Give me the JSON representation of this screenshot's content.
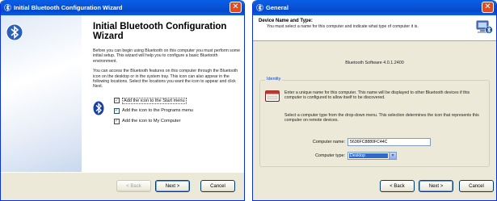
{
  "left_window": {
    "title": "Initial Bluetooth Configuration Wizard",
    "heading": "Initial Bluetooth Configuration Wizard",
    "para1": "Before you can begin using Bluetooth on this computer you must perform some initial setup. This wizard will help you to configure a basic Bluetooth environment.",
    "para2": "You can access the Bluetooth features on this computer through the Bluetooth icon on the desktop or in the system tray. This icon can also appear in the following locations. Select the locations you want the icon to appear and click Next.",
    "checkboxes": [
      {
        "label": "Add the icon to the Start menu",
        "checked": true
      },
      {
        "label": "Add the icon to the Programs menu",
        "checked": true
      },
      {
        "label": "Add the icon to My Computer",
        "checked": true
      }
    ],
    "buttons": {
      "back": "< Back",
      "next": "Next >",
      "cancel": "Cancel"
    }
  },
  "right_window": {
    "title": "General",
    "header_title": "Device Name and Type:",
    "header_subtitle": "You must select a name for this computer and indicate what type of computer it is.",
    "software_version": "Bluetooth Software 4.0.1.2400",
    "identity_legend": "Identity",
    "identity_para1": "Enter a unique name for this computer. This name will be displayed to other Bluetooth devices if this computer is configured to allow itself to be discovered.",
    "identity_para2": "Select a computer type from the drop-down menu. This selection determines the icon that represents this computer on remote devices.",
    "computer_name_label": "Computer name:",
    "computer_name_value": "5636FC8880FC44C",
    "computer_type_label": "Computer type:",
    "computer_type_value": "Desktop",
    "buttons": {
      "back": "< Back",
      "next": "Next >",
      "cancel": "Cancel"
    }
  },
  "colors": {
    "titlebar": "#0853d6",
    "dialog_bg": "#ece9d8",
    "close": "#e04b24",
    "selection": "#316ac5"
  }
}
